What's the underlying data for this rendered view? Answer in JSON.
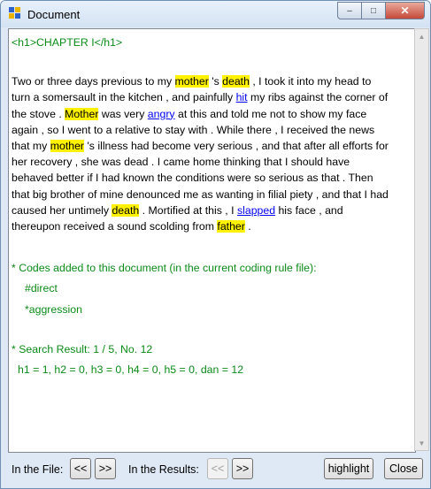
{
  "window": {
    "title": "Document"
  },
  "controls": {
    "minimize": "–",
    "maximize": "□",
    "close": "✕"
  },
  "document": {
    "heading": "<h1>CHAPTER I</h1>",
    "p": [
      " Two or three days previous to my ",
      "mother",
      " 's ",
      "death",
      " , I took it into my head to turn a somersault in the kitchen , and painfully ",
      "hit",
      " my ribs against the corner of the stove . ",
      "Mother",
      " was very ",
      "angry",
      " at this and told me not to show my face again , so I went to a relative to stay with . While there , I received the news that my ",
      "mother",
      " 's illness had become very serious , and that after all efforts for her recovery , she was dead . I came home thinking that I should have behaved better if I had known the conditions were so serious as that . Then that big brother of mine denounced me as wanting in filial piety , and that I had caused her untimely ",
      "death",
      " . Mortified at this , I ",
      "slapped",
      " his face , and thereupon received a sound scolding from ",
      "father",
      " ."
    ],
    "codes_header": "* Codes added to this document (in the current coding rule file):",
    "codes": [
      "#direct",
      "*aggression"
    ],
    "search_result": "* Search Result: 1 / 5,  No. 12",
    "counts": "h1 = 1,  h2 = 0,  h3 = 0,  h4 = 0,  h5 = 0,  dan = 12"
  },
  "bottom": {
    "in_file_label": "In the File:",
    "prev_label": "<<",
    "next_label": ">>",
    "in_results_label": "In the Results:",
    "res_prev_label": "<<",
    "res_next_label": ">>",
    "highlight_label": "highlight",
    "close_label": "Close"
  }
}
